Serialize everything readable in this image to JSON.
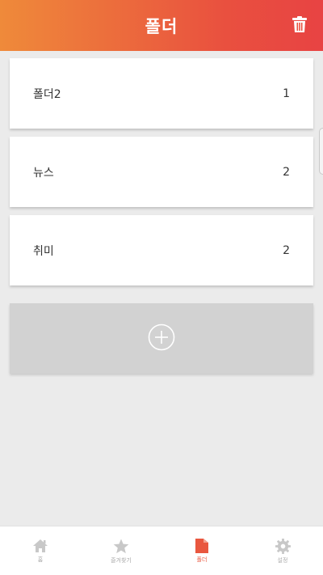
{
  "header": {
    "title": "폴더",
    "trash_icon": "trash-icon"
  },
  "folders": [
    {
      "name": "폴더2",
      "count": "1"
    },
    {
      "name": "뉴스",
      "count": "2"
    },
    {
      "name": "취미",
      "count": "2"
    }
  ],
  "add_folder": {
    "icon": "plus-circle-icon"
  },
  "tabs": [
    {
      "label": "홈",
      "icon": "home-icon",
      "active": false
    },
    {
      "label": "즐겨찾기",
      "icon": "star-icon",
      "active": false
    },
    {
      "label": "폴더",
      "icon": "folder-icon",
      "active": true
    },
    {
      "label": "설정",
      "icon": "gear-icon",
      "active": false
    }
  ],
  "colors": {
    "header_start": "#ef8a3a",
    "header_end": "#e84343",
    "accent": "#e9573f",
    "inactive": "#c8c8c8"
  }
}
